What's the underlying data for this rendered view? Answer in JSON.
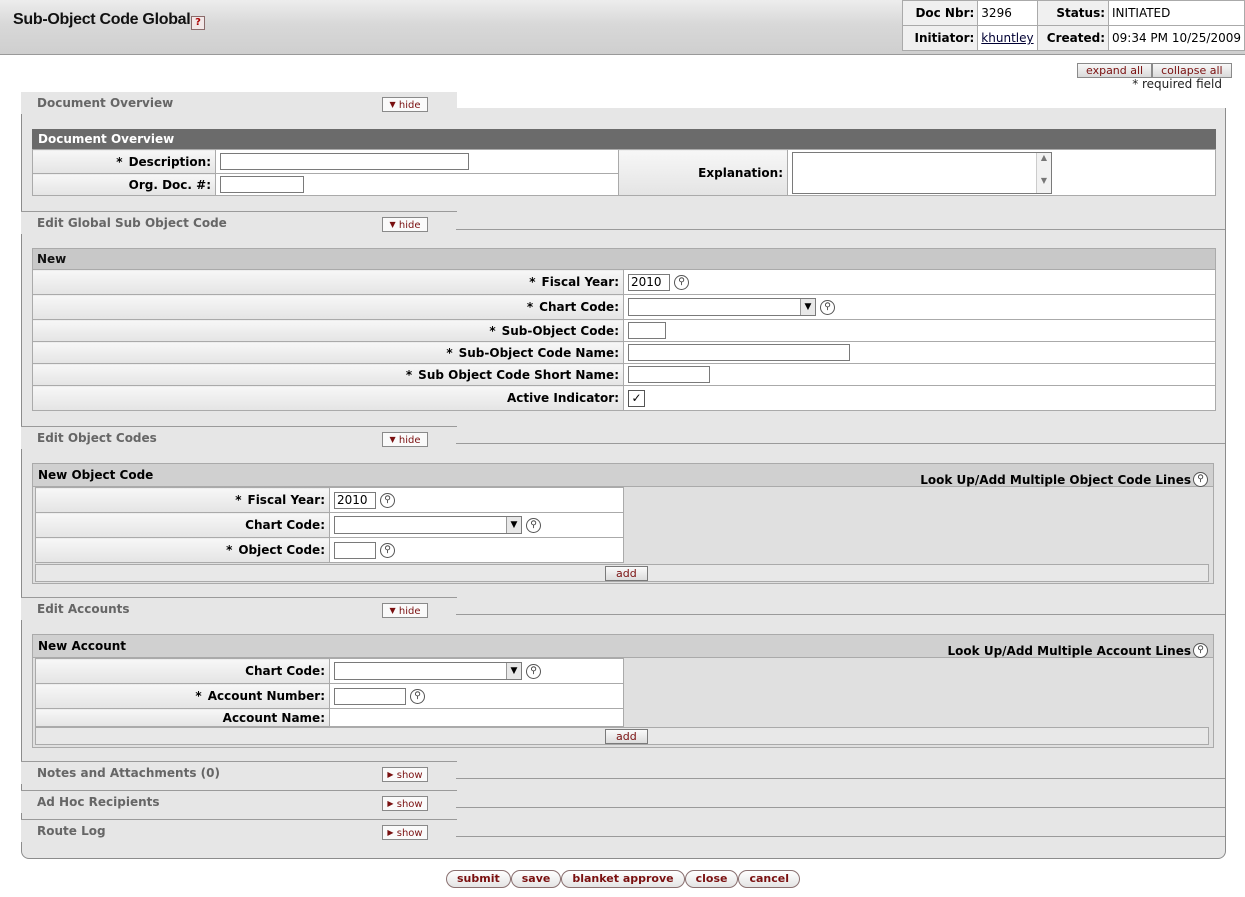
{
  "header": {
    "title": "Sub-Object Code Global",
    "help_glyph": "?",
    "doc_nbr_label": "Doc Nbr:",
    "doc_nbr": "3296",
    "status_label": "Status:",
    "status": "INITIATED",
    "initiator_label": "Initiator:",
    "initiator": "khuntley",
    "created_label": "Created:",
    "created": "09:34 PM 10/25/2009"
  },
  "controls": {
    "expand_all": "expand all",
    "collapse_all": "collapse all",
    "required_note": "* required field"
  },
  "document_overview": {
    "tab_label": "Document Overview",
    "toggle": "hide",
    "section_title": "Document Overview",
    "description_label": "Description:",
    "org_doc_label": "Org. Doc. #:",
    "explanation_label": "Explanation:"
  },
  "edit_global": {
    "tab_label": "Edit Global Sub Object Code",
    "toggle": "hide",
    "sub_title": "New",
    "fiscal_year_label": "Fiscal Year:",
    "fiscal_year": "2010",
    "chart_code_label": "Chart Code:",
    "sub_object_code_label": "Sub-Object Code:",
    "sub_object_code_name_label": "Sub-Object Code Name:",
    "short_name_label": "Sub Object Code Short Name:",
    "active_label": "Active Indicator:"
  },
  "edit_object_codes": {
    "tab_label": "Edit Object Codes",
    "toggle": "hide",
    "sub_title": "New Object Code",
    "lookup_label": "Look Up/Add Multiple Object Code Lines",
    "fiscal_year_label": "Fiscal Year:",
    "fiscal_year": "2010",
    "chart_code_label": "Chart Code:",
    "object_code_label": "Object Code:",
    "add": "add"
  },
  "edit_accounts": {
    "tab_label": "Edit Accounts",
    "toggle": "hide",
    "sub_title": "New Account",
    "lookup_label": "Look Up/Add Multiple Account Lines",
    "chart_code_label": "Chart Code:",
    "account_number_label": "Account Number:",
    "account_name_label": "Account Name:",
    "add": "add"
  },
  "collapsed_tabs": [
    {
      "label": "Notes and Attachments (0)",
      "toggle": "show"
    },
    {
      "label": "Ad Hoc Recipients",
      "toggle": "show"
    },
    {
      "label": "Route Log",
      "toggle": "show"
    }
  ],
  "actions": {
    "submit": "submit",
    "save": "save",
    "blanket_approve": "blanket approve",
    "close": "close",
    "cancel": "cancel"
  },
  "symbols": {
    "required": "*",
    "checkmark": "✓",
    "dropdown_arrow": "▼",
    "search_icon": "search-icon",
    "scroll_up": "▲",
    "scroll_down": "▼",
    "hide_triangle": "▼",
    "show_triangle": "▶"
  }
}
